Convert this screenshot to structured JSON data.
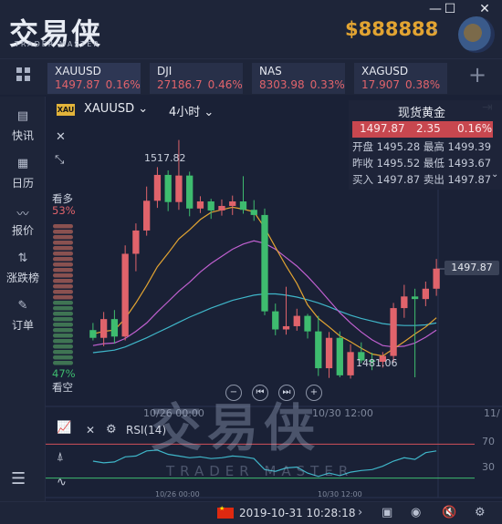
{
  "app": {
    "logo_text": "交易侠",
    "logo_subtitle": "TRADER MASTER"
  },
  "window_controls": {
    "minimize": "—",
    "maximize": "☐",
    "close": "✕"
  },
  "account": {
    "balance": "$888888",
    "dropdown_arrow": "⌄"
  },
  "tickers": [
    {
      "symbol": "XAUUSD",
      "price": "1497.87",
      "change": "0.16%"
    },
    {
      "symbol": "DJI",
      "price": "27186.7",
      "change": "0.46%"
    },
    {
      "symbol": "NAS",
      "price": "8303.98",
      "change": "0.33%"
    },
    {
      "symbol": "XAGUSD",
      "price": "17.907",
      "change": "0.38%"
    }
  ],
  "add_tab": "+",
  "sidebar": {
    "items": [
      {
        "label": "快讯",
        "icon": "news-icon"
      },
      {
        "label": "日历",
        "icon": "calendar-icon"
      },
      {
        "label": "报价",
        "icon": "quote-icon"
      },
      {
        "label": "涨跌榜",
        "icon": "ranking-icon"
      },
      {
        "label": "订单",
        "icon": "order-icon"
      }
    ],
    "menu_icon": "☰"
  },
  "chart_header": {
    "badge": "XAU",
    "symbol": "XAUUSD",
    "timeframe": "4小时"
  },
  "sentiment": {
    "bull_label": "看多",
    "bull_pct": "53%",
    "bear_pct": "47%",
    "bear_label": "看空"
  },
  "quote_panel": {
    "title": "现货黄金",
    "price": "1497.87",
    "change": "2.35",
    "change_pct": "0.16%",
    "rows": [
      "开盘 1495.28 最高 1499.39",
      "昨收 1495.52 最低 1493.67",
      "买入 1497.87 卖出 1497.87"
    ]
  },
  "price_labels": {
    "current": "1497.87",
    "high": "1517.82",
    "low": "1481.06"
  },
  "x_labels": {
    "d1": "10/26 00:00",
    "d2": "10/30 12:00",
    "d3": "11/",
    "s1": "10/26 00:00",
    "s2": "10/30 12:00"
  },
  "rsi": {
    "label": "RSI(14)",
    "level_high": "70",
    "level_low": "30"
  },
  "watermark": {
    "main": "交易侠",
    "sub": "TRADER MASTER"
  },
  "status": {
    "datetime": "2019-10-31 10:28:18"
  },
  "colors": {
    "up": "#e0636b",
    "down": "#3ebc6f",
    "ma_fast": "#e2a432",
    "ma_mid": "#c060d0",
    "ma_slow": "#3fb6c9",
    "rsi": "#3fb6c9"
  },
  "chart_data": {
    "type": "candlestick",
    "candles": [
      {
        "o": 1488.4,
        "h": 1489.5,
        "l": 1486.8,
        "c": 1487.2
      },
      {
        "o": 1487.2,
        "h": 1491.2,
        "l": 1485.9,
        "c": 1490.1
      },
      {
        "o": 1490.1,
        "h": 1491.5,
        "l": 1486.3,
        "c": 1487.4
      },
      {
        "o": 1487.4,
        "h": 1501.5,
        "l": 1486.8,
        "c": 1500.2
      },
      {
        "o": 1500.2,
        "h": 1504.9,
        "l": 1497.5,
        "c": 1503.8
      },
      {
        "o": 1503.8,
        "h": 1510.6,
        "l": 1503.0,
        "c": 1508.4
      },
      {
        "o": 1508.4,
        "h": 1513.6,
        "l": 1507.3,
        "c": 1512.4
      },
      {
        "o": 1512.4,
        "h": 1513.1,
        "l": 1506.8,
        "c": 1508.2
      },
      {
        "o": 1508.2,
        "h": 1517.8,
        "l": 1507.0,
        "c": 1512.3
      },
      {
        "o": 1512.3,
        "h": 1512.9,
        "l": 1506.0,
        "c": 1507.2
      },
      {
        "o": 1507.2,
        "h": 1509.1,
        "l": 1506.5,
        "c": 1508.3
      },
      {
        "o": 1508.3,
        "h": 1508.7,
        "l": 1505.6,
        "c": 1506.9
      },
      {
        "o": 1506.9,
        "h": 1508.6,
        "l": 1506.1,
        "c": 1507.6
      },
      {
        "o": 1507.6,
        "h": 1509.2,
        "l": 1506.2,
        "c": 1508.3
      },
      {
        "o": 1508.3,
        "h": 1512.2,
        "l": 1506.4,
        "c": 1507.0
      },
      {
        "o": 1507.0,
        "h": 1508.5,
        "l": 1505.3,
        "c": 1506.2
      },
      {
        "o": 1506.2,
        "h": 1507.2,
        "l": 1490.7,
        "c": 1491.3
      },
      {
        "o": 1491.3,
        "h": 1492.5,
        "l": 1487.6,
        "c": 1488.5
      },
      {
        "o": 1488.5,
        "h": 1495.1,
        "l": 1487.7,
        "c": 1489.0
      },
      {
        "o": 1489.0,
        "h": 1491.7,
        "l": 1488.3,
        "c": 1490.6
      },
      {
        "o": 1490.6,
        "h": 1490.9,
        "l": 1487.1,
        "c": 1488.2
      },
      {
        "o": 1488.2,
        "h": 1490.6,
        "l": 1481.3,
        "c": 1482.5
      },
      {
        "o": 1482.5,
        "h": 1488.1,
        "l": 1481.0,
        "c": 1487.2
      },
      {
        "o": 1487.2,
        "h": 1488.2,
        "l": 1481.1,
        "c": 1481.4
      },
      {
        "o": 1481.4,
        "h": 1486.2,
        "l": 1480.9,
        "c": 1485.0
      },
      {
        "o": 1485.0,
        "h": 1486.5,
        "l": 1483.3,
        "c": 1483.7
      },
      {
        "o": 1483.7,
        "h": 1484.9,
        "l": 1482.2,
        "c": 1483.5
      },
      {
        "o": 1483.5,
        "h": 1485.0,
        "l": 1482.6,
        "c": 1484.4
      },
      {
        "o": 1484.4,
        "h": 1492.6,
        "l": 1483.5,
        "c": 1491.8
      },
      {
        "o": 1491.8,
        "h": 1495.4,
        "l": 1490.3,
        "c": 1493.6
      },
      {
        "o": 1493.6,
        "h": 1494.8,
        "l": 1481.1,
        "c": 1493.2
      },
      {
        "o": 1493.2,
        "h": 1495.9,
        "l": 1492.1,
        "c": 1494.8
      },
      {
        "o": 1494.8,
        "h": 1499.4,
        "l": 1493.7,
        "c": 1497.9
      }
    ],
    "ma_fast": [
      1487.8,
      1488.2,
      1488.4,
      1490.2,
      1492.6,
      1495.3,
      1498.2,
      1500.3,
      1502.5,
      1503.9,
      1505.5,
      1506.6,
      1507.0,
      1507.4,
      1507.1,
      1506.7,
      1504.2,
      1501.2,
      1498.3,
      1495.6,
      1492.3,
      1490.2,
      1488.9,
      1487.5,
      1486.6,
      1485.6,
      1484.7,
      1484.4,
      1485.5,
      1486.6,
      1487.8,
      1488.9,
      1490.3
    ],
    "ma_mid": [
      1486.0,
      1486.3,
      1486.4,
      1487.1,
      1488.2,
      1489.5,
      1491.2,
      1492.8,
      1494.4,
      1495.8,
      1497.4,
      1498.7,
      1499.8,
      1500.9,
      1501.7,
      1502.2,
      1501.8,
      1500.9,
      1499.6,
      1498.3,
      1496.7,
      1494.9,
      1493.0,
      1491.1,
      1489.5,
      1488.1,
      1486.9,
      1486.0,
      1485.8,
      1485.9,
      1486.4,
      1487.3,
      1488.4
    ],
    "ma_slow": [
      1484.9,
      1485.1,
      1485.3,
      1485.8,
      1486.5,
      1487.2,
      1488.0,
      1488.8,
      1489.6,
      1490.4,
      1491.1,
      1491.8,
      1492.4,
      1493.0,
      1493.4,
      1493.8,
      1494.0,
      1494.0,
      1493.8,
      1493.5,
      1493.1,
      1492.6,
      1492.0,
      1491.3,
      1490.7,
      1490.2,
      1489.8,
      1489.4,
      1489.2,
      1489.1,
      1489.1,
      1489.2,
      1489.5
    ],
    "rsi": [
      50,
      48,
      49,
      55,
      56,
      62,
      63,
      58,
      56,
      54,
      55,
      53,
      54,
      56,
      55,
      53,
      40,
      38,
      42,
      43,
      36,
      32,
      36,
      33,
      37,
      39,
      40,
      44,
      50,
      54,
      52,
      60,
      62
    ],
    "rsi_levels": [
      70,
      30
    ],
    "y_range": [
      1478,
      1520
    ],
    "rsi_range": [
      20,
      80
    ]
  }
}
